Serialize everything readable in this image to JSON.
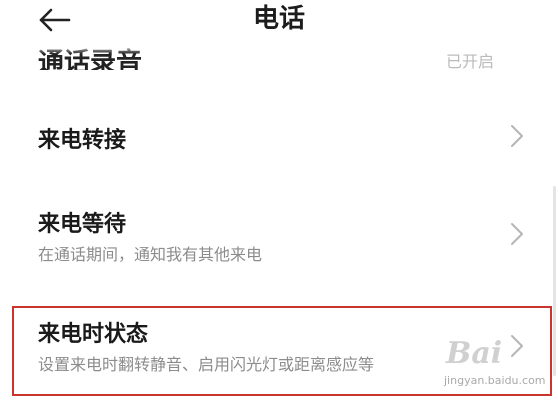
{
  "header": {
    "back_icon": "arrow-left-icon",
    "title": "电话"
  },
  "partial_row": {
    "label": "通话录音",
    "value": "已开启"
  },
  "rows": [
    {
      "title": "来电转接",
      "subtitle": "",
      "chevron_icon": "chevron-right-icon"
    },
    {
      "title": "来电等待",
      "subtitle": "在通话期间，通知我有其他来电",
      "chevron_icon": "chevron-right-icon"
    },
    {
      "title": "来电时状态",
      "subtitle": "设置来电时翻转静音、启用闪光灯或距离感应等",
      "chevron_icon": "chevron-right-icon",
      "highlighted": true
    }
  ],
  "watermark": {
    "logo_text": "Bai",
    "url": "jingyan.baidu.com"
  },
  "colors": {
    "highlight_border": "#c9342c",
    "title_text": "#1a1a1a",
    "subtitle_text": "#8c8c8c",
    "chevron": "#b5b5b5",
    "background": "#ffffff"
  }
}
